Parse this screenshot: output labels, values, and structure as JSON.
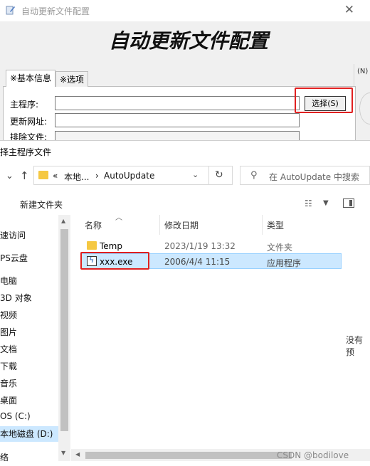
{
  "background_window": {
    "title": "自动更新文件配置",
    "heading": "自动更新文件配置",
    "side_shortcut": "(N)",
    "tabs": [
      {
        "label": "※基本信息",
        "active": true
      },
      {
        "label": "※选项",
        "active": false
      }
    ],
    "fields": [
      {
        "label": "主程序:",
        "value": ""
      },
      {
        "label": "更新网址:",
        "value": ""
      },
      {
        "label": "排除文件:",
        "value": ""
      }
    ],
    "choose_button": "选择(S)"
  },
  "file_dialog": {
    "title": "择主程序文件",
    "address": {
      "overflow": "«",
      "segments": [
        "本地...",
        "AutoUpdate"
      ],
      "separator": "›"
    },
    "search_placeholder": "在 AutoUpdate 中搜索",
    "new_folder_button": "新建文件夹",
    "nav_items": [
      "速访问",
      "PS云盘",
      "电脑",
      "3D 对象",
      "视频",
      "图片",
      "文档",
      "下载",
      "音乐",
      "桌面",
      "OS (C:)",
      "本地磁盘 (D:)",
      "络"
    ],
    "selected_nav": "本地磁盘 (D:)",
    "columns": [
      "名称",
      "修改日期",
      "类型"
    ],
    "files": [
      {
        "name": "Temp",
        "modified": "2023/1/19 13:32",
        "type": "文件夹",
        "icon": "folder-icon"
      },
      {
        "name": "xxx.exe",
        "modified": "2006/4/4 11:15",
        "type": "应用程序",
        "icon": "exe-icon"
      }
    ],
    "preview_note": "没有预",
    "watermark": "CSDN @bodilove"
  },
  "colors": {
    "highlight_red": "#e02020",
    "selection_blue": "#cce8ff",
    "folder_yellow": "#f5c842"
  }
}
